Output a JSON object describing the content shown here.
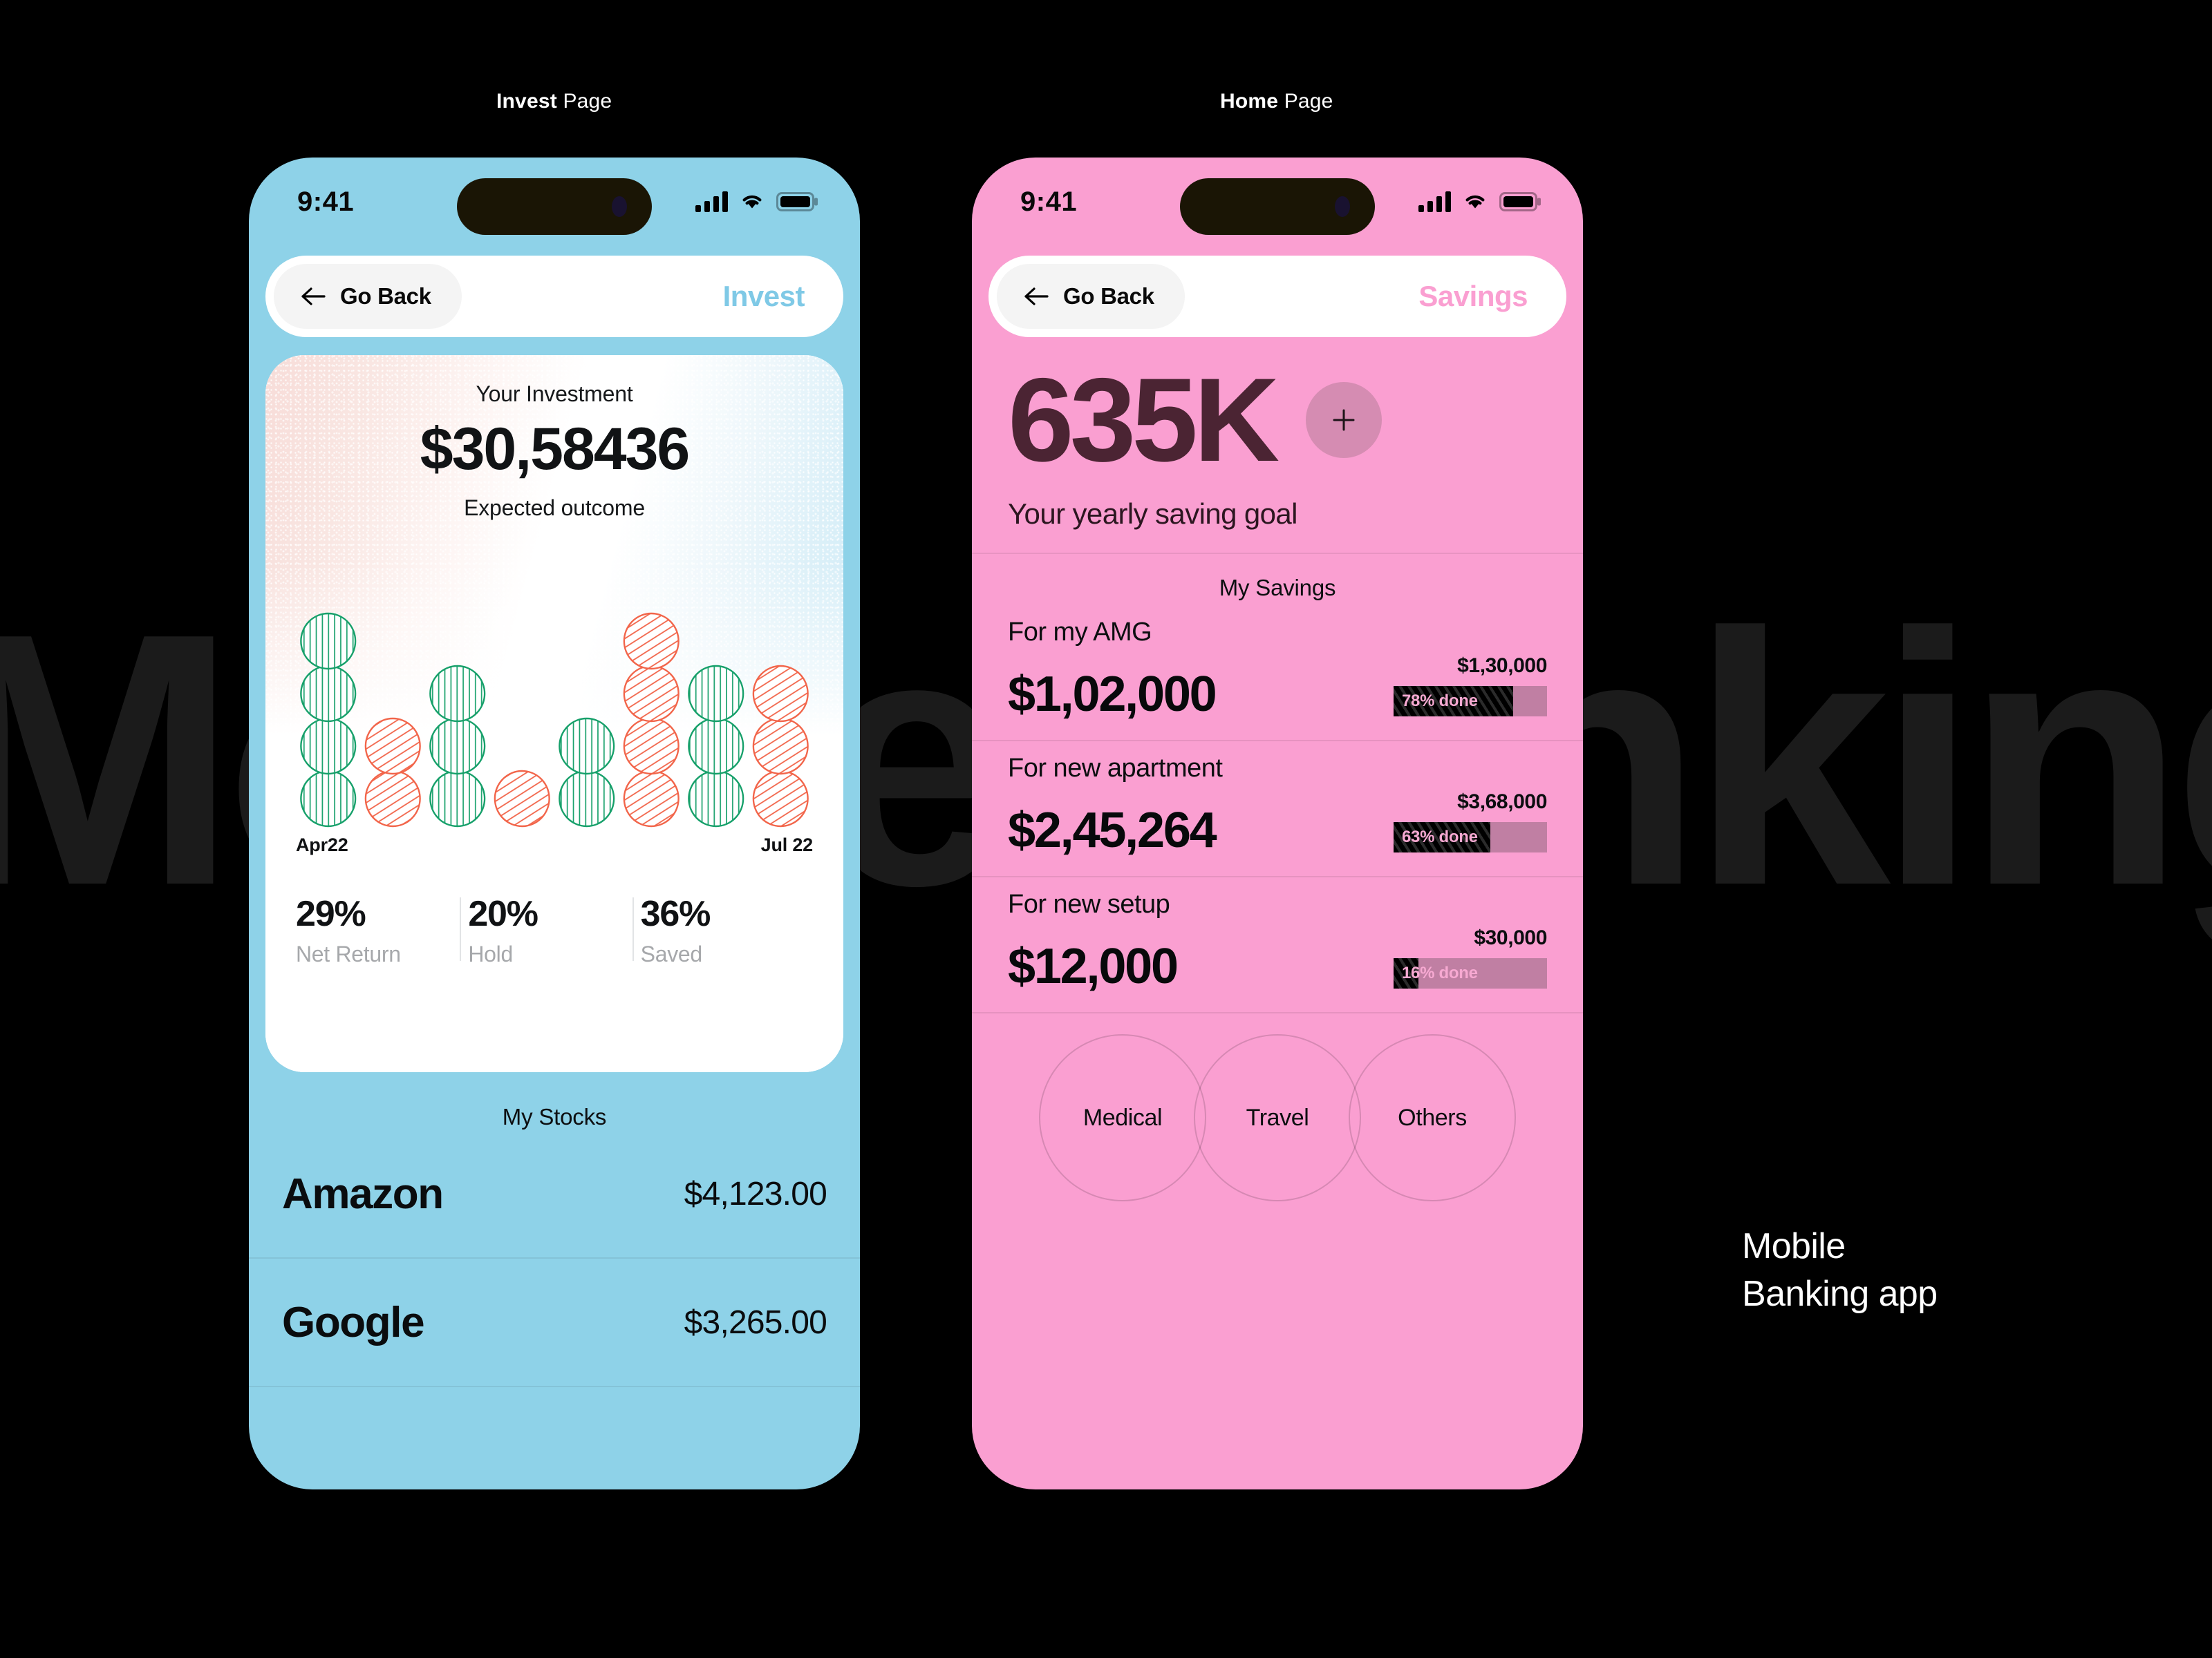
{
  "background": {
    "watermark_text": "Mobile banking",
    "color": "#000000",
    "watermark_color": "#1b1b1b"
  },
  "captions": {
    "invest_bold": "Invest",
    "invest_rest": " Page",
    "home_bold": "Home",
    "home_rest": " Page"
  },
  "footer": {
    "line1": "Mobile",
    "line2": "Banking app"
  },
  "invest_phone": {
    "accent_color": "#8ed2e8",
    "status": {
      "time": "9:41",
      "signal_icon": "cellular-signal-icon",
      "wifi_icon": "wifi-icon",
      "battery_icon": "battery-icon"
    },
    "nav": {
      "back_icon": "arrow-left-icon",
      "back_label": "Go Back",
      "title": "Invest"
    },
    "card": {
      "kicker": "Your Investment",
      "amount": "$30,58436",
      "subtitle": "Expected outcome",
      "axis_start": "Apr22",
      "axis_end": "Jul 22",
      "stats": [
        {
          "value": "29%",
          "label": "Net Return"
        },
        {
          "value": "20%",
          "label": "Hold"
        },
        {
          "value": "36%",
          "label": "Saved"
        }
      ]
    },
    "stocks_title": "My Stocks",
    "stocks": [
      {
        "name": "Amazon",
        "value": "$4,123.00"
      },
      {
        "name": "Google",
        "value": "$3,265.00"
      }
    ]
  },
  "home_phone": {
    "accent_color": "#fa9fd1",
    "status": {
      "time": "9:41",
      "signal_icon": "cellular-signal-icon",
      "wifi_icon": "wifi-icon",
      "battery_icon": "battery-icon"
    },
    "nav": {
      "back_icon": "arrow-left-icon",
      "back_label": "Go Back",
      "title": "Savings"
    },
    "hero": {
      "amount": "635K",
      "add_icon": "plus-icon",
      "caption": "Your yearly saving goal"
    },
    "savings_title": "My Savings",
    "savings": [
      {
        "title": "For my AMG",
        "amount": "$1,02,000",
        "target": "$1,30,000",
        "progress_label": "78% done",
        "progress_percent": 78
      },
      {
        "title": "For new apartment",
        "amount": "$2,45,264",
        "target": "$3,68,000",
        "progress_label": "63% done",
        "progress_percent": 63
      },
      {
        "title": "For new setup",
        "amount": "$12,000",
        "target": "$30,000",
        "progress_label": "16% done",
        "progress_percent": 16
      }
    ],
    "categories": [
      {
        "label": "Medical"
      },
      {
        "label": "Travel"
      },
      {
        "label": "Others"
      }
    ]
  },
  "chart_data": {
    "type": "bar",
    "title": "Expected outcome",
    "xlabel": "",
    "ylabel": "",
    "grid": false,
    "legend": [
      "green-vertical-hatch",
      "red-diagonal-hatch"
    ],
    "x": [
      "Apr22",
      "",
      "",
      "",
      "",
      "",
      "",
      "Jul 22"
    ],
    "axis_tick_labels": [
      "Apr22",
      "Jul 22"
    ],
    "unit": "stacked circle tokens",
    "ylim": [
      0,
      4
    ],
    "colors": {
      "green": "#16a06a",
      "red": "#f2654a"
    },
    "columns": [
      {
        "index": 0,
        "total": 4,
        "tokens": [
          "green",
          "green",
          "green",
          "green"
        ]
      },
      {
        "index": 1,
        "total": 2,
        "tokens": [
          "red",
          "red"
        ]
      },
      {
        "index": 2,
        "total": 3,
        "tokens": [
          "green",
          "green",
          "green"
        ]
      },
      {
        "index": 3,
        "total": 1,
        "tokens": [
          "red"
        ]
      },
      {
        "index": 4,
        "total": 2,
        "tokens": [
          "green",
          "green"
        ]
      },
      {
        "index": 5,
        "total": 4,
        "tokens": [
          "red",
          "red",
          "red",
          "red"
        ]
      },
      {
        "index": 6,
        "total": 3,
        "tokens": [
          "green",
          "green",
          "green"
        ]
      },
      {
        "index": 7,
        "total": 3,
        "tokens": [
          "red",
          "red",
          "red"
        ]
      }
    ],
    "series": [
      {
        "name": "green-vertical-hatch",
        "values": [
          4,
          0,
          3,
          0,
          2,
          0,
          3,
          0
        ]
      },
      {
        "name": "red-diagonal-hatch",
        "values": [
          0,
          2,
          0,
          1,
          0,
          4,
          0,
          3
        ]
      }
    ]
  }
}
